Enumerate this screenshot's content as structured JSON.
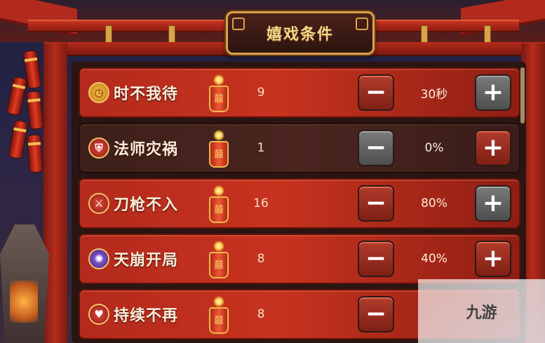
{
  "title": "嬉戏条件",
  "rows": [
    {
      "label": "时不我待",
      "icon": "clock-icon",
      "count": "9",
      "value": "30秒",
      "style": "red"
    },
    {
      "label": "法师灾祸",
      "icon": "shield-icon",
      "count": "1",
      "value": "0%",
      "style": "dark"
    },
    {
      "label": "刀枪不入",
      "icon": "sword-icon",
      "count": "16",
      "value": "80%",
      "style": "red"
    },
    {
      "label": "天崩开局",
      "icon": "burst-icon",
      "count": "8",
      "value": "40%",
      "style": "red"
    },
    {
      "label": "持续不再",
      "icon": "heart-icon",
      "count": "8",
      "value": "",
      "style": "red"
    }
  ],
  "buttons": {
    "minus": "−",
    "plus": "+"
  },
  "watermark": "九游"
}
